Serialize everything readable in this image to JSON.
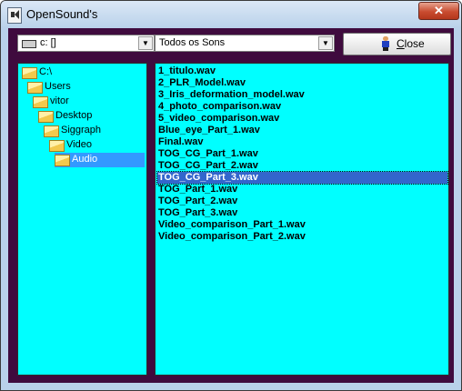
{
  "window": {
    "title": "OpenSound's",
    "close_glyph": "✕"
  },
  "toolbar": {
    "drive_value": "c: []",
    "drive_icon": "drive-icon",
    "filter_value": "Todos os Sons",
    "combo_arrow": "▼",
    "close_button": {
      "underlined": "C",
      "rest": "lose"
    }
  },
  "tree": {
    "items": [
      {
        "label": "C:\\",
        "indent": 0,
        "open": true
      },
      {
        "label": "Users",
        "indent": 1,
        "open": true
      },
      {
        "label": "vitor",
        "indent": 2,
        "open": true
      },
      {
        "label": "Desktop",
        "indent": 3,
        "open": true
      },
      {
        "label": "Siggraph",
        "indent": 4,
        "open": true
      },
      {
        "label": "Video",
        "indent": 5,
        "open": true
      },
      {
        "label": "Audio",
        "indent": 6,
        "open": true,
        "selected": true
      }
    ]
  },
  "files": {
    "items": [
      "1_titulo.wav",
      "2_PLR_Model.wav",
      "3_Iris_deformation_model.wav",
      "4_photo_comparison.wav",
      "5_video_comparison.wav",
      "Blue_eye_Part_1.wav",
      "Final.wav",
      "TOG_CG_Part_1.wav",
      "TOG_CG_Part_2.wav",
      "TOG_CG_Part_3.wav",
      "TOG_Part_1.wav",
      "TOG_Part_2.wav",
      "TOG_Part_3.wav",
      "Video_comparison_Part_1.wav",
      "Video_comparison_Part_2.wav"
    ],
    "selected_index": 9
  },
  "colors": {
    "panel_bg": "#00ffff",
    "client_bg": "#3f0b3e",
    "selection": "#3399ff"
  }
}
